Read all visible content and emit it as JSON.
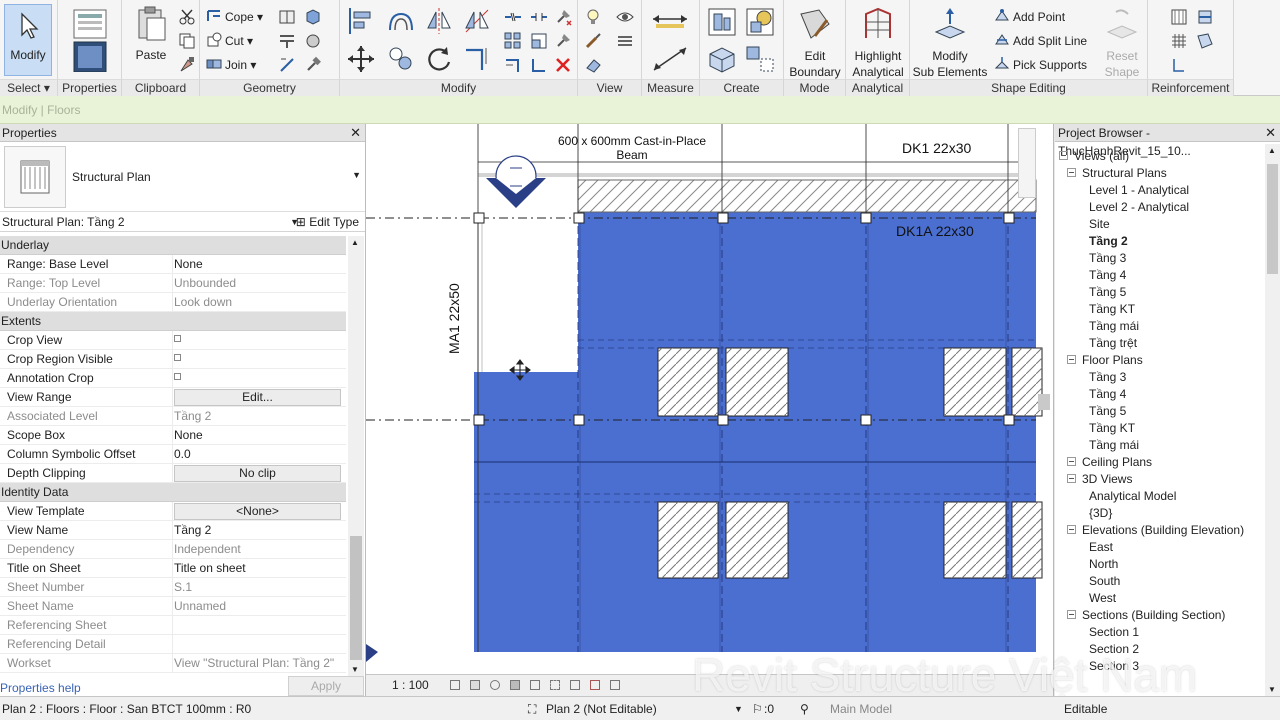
{
  "ribbon": {
    "modify": {
      "label": "Modify",
      "select": "Select"
    },
    "properties": {
      "label": "Properties"
    },
    "clipboard": {
      "label": "Clipboard",
      "paste": "Paste"
    },
    "geometry": {
      "label": "Geometry",
      "cope": "Cope",
      "cut": "Cut",
      "join": "Join"
    },
    "modify_panel": {
      "label": "Modify"
    },
    "view": {
      "label": "View"
    },
    "measure": {
      "label": "Measure"
    },
    "create": {
      "label": "Create"
    },
    "mode": {
      "label": "Mode",
      "edit_boundary": "Edit\nBoundary"
    },
    "analytical": {
      "label": "Analytical",
      "highlight_analytical": "Highlight\nAnalytical"
    },
    "shape_editing": {
      "label": "Shape Editing",
      "modify_sub": "Modify\nSub Elements",
      "add_point": "Add Point",
      "add_split_line": "Add Split Line",
      "pick_supports": "Pick Supports",
      "reset_shape": "Reset\nShape"
    },
    "reinforcement": {
      "label": "Reinforcement"
    }
  },
  "mode_strip": "Modify | Floors",
  "properties": {
    "title": "Properties",
    "type_name": "Structural Plan",
    "instance": "Structural Plan: Tầng 2",
    "edit_type": "Edit Type",
    "help": "Properties help",
    "apply": "Apply",
    "groups": [
      {
        "name": "Underlay",
        "rows": [
          {
            "k": "Range: Base Level",
            "v": "None",
            "dim": false
          },
          {
            "k": "Range: Top Level",
            "v": "Unbounded",
            "dim": true
          },
          {
            "k": "Underlay Orientation",
            "v": "Look down",
            "dim": true
          }
        ]
      },
      {
        "name": "Extents",
        "rows": [
          {
            "k": "Crop View",
            "v": "",
            "check": true,
            "dim": false
          },
          {
            "k": "Crop Region Visible",
            "v": "",
            "check": true,
            "dim": false
          },
          {
            "k": "Annotation Crop",
            "v": "",
            "check": true,
            "dim": false
          },
          {
            "k": "View Range",
            "v": "Edit...",
            "button": true,
            "dim": false
          },
          {
            "k": "Associated Level",
            "v": "Tầng 2",
            "dim": true
          },
          {
            "k": "Scope Box",
            "v": "None",
            "dim": false
          },
          {
            "k": "Column Symbolic Offset",
            "v": "0.0",
            "dim": false
          },
          {
            "k": "Depth Clipping",
            "v": "No clip",
            "button": true,
            "dim": false
          }
        ]
      },
      {
        "name": "Identity Data",
        "rows": [
          {
            "k": "View Template",
            "v": "<None>",
            "button": true,
            "dim": false
          },
          {
            "k": "View Name",
            "v": "Tầng 2",
            "dim": false
          },
          {
            "k": "Dependency",
            "v": "Independent",
            "dim": true
          },
          {
            "k": "Title on Sheet",
            "v": "Title on sheet",
            "dim": false
          },
          {
            "k": "Sheet Number",
            "v": "S.1",
            "dim": true
          },
          {
            "k": "Sheet Name",
            "v": "Unnamed",
            "dim": true
          },
          {
            "k": "Referencing Sheet",
            "v": "",
            "dim": true
          },
          {
            "k": "Referencing Detail",
            "v": "",
            "dim": true
          },
          {
            "k": "Workset",
            "v": "View \"Structural Plan: Tầng 2\"",
            "dim": true
          }
        ]
      }
    ]
  },
  "canvas": {
    "beam_label": "600 x 600mm Cast-in-Place\nBeam",
    "dk1": "DK1 22x30",
    "dk1a": "DK1A 22x30",
    "ma1": "MA1 22x50",
    "scale": "1 : 100",
    "colors": {
      "floor": "#4a6fd0",
      "floor_dark": "#3e60c2"
    }
  },
  "browser": {
    "title": "Project Browser - ThucHanhRevit_15_10...",
    "nodes": [
      {
        "t": "Views (all)",
        "lvl": 0,
        "toggle": true
      },
      {
        "t": "Structural Plans",
        "lvl": 1,
        "toggle": true
      },
      {
        "t": "Level 1 - Analytical",
        "lvl": 2
      },
      {
        "t": "Level 2 - Analytical",
        "lvl": 2
      },
      {
        "t": "Site",
        "lvl": 2
      },
      {
        "t": "Tầng 2",
        "lvl": 2,
        "bold": true
      },
      {
        "t": "Tầng 3",
        "lvl": 2
      },
      {
        "t": "Tầng 4",
        "lvl": 2
      },
      {
        "t": "Tầng 5",
        "lvl": 2
      },
      {
        "t": "Tầng KT",
        "lvl": 2
      },
      {
        "t": "Tầng mái",
        "lvl": 2
      },
      {
        "t": "Tầng trệt",
        "lvl": 2
      },
      {
        "t": "Floor Plans",
        "lvl": 1,
        "toggle": true
      },
      {
        "t": "Tầng 3",
        "lvl": 2
      },
      {
        "t": "Tầng 4",
        "lvl": 2
      },
      {
        "t": "Tầng 5",
        "lvl": 2
      },
      {
        "t": "Tầng KT",
        "lvl": 2
      },
      {
        "t": "Tầng mái",
        "lvl": 2
      },
      {
        "t": "Ceiling Plans",
        "lvl": 1,
        "toggle": true
      },
      {
        "t": "3D Views",
        "lvl": 1,
        "toggle": true
      },
      {
        "t": "Analytical Model",
        "lvl": 2
      },
      {
        "t": "{3D}",
        "lvl": 2
      },
      {
        "t": "Elevations (Building Elevation)",
        "lvl": 1,
        "toggle": true
      },
      {
        "t": "East",
        "lvl": 2
      },
      {
        "t": "North",
        "lvl": 2
      },
      {
        "t": "South",
        "lvl": 2
      },
      {
        "t": "West",
        "lvl": 2
      },
      {
        "t": "Sections (Building Section)",
        "lvl": 1,
        "toggle": true
      },
      {
        "t": "Section 1",
        "lvl": 2
      },
      {
        "t": "Section 2",
        "lvl": 2
      },
      {
        "t": "Section 3",
        "lvl": 2
      }
    ]
  },
  "status": {
    "left": "Plan 2 : Floors : Floor : San BTCT 100mm : R0",
    "view": "Plan 2 (Not Editable)",
    "count": ":0",
    "model": "Main Model",
    "editable": "Editable"
  },
  "watermark": "Revit Structure Việt Nam"
}
